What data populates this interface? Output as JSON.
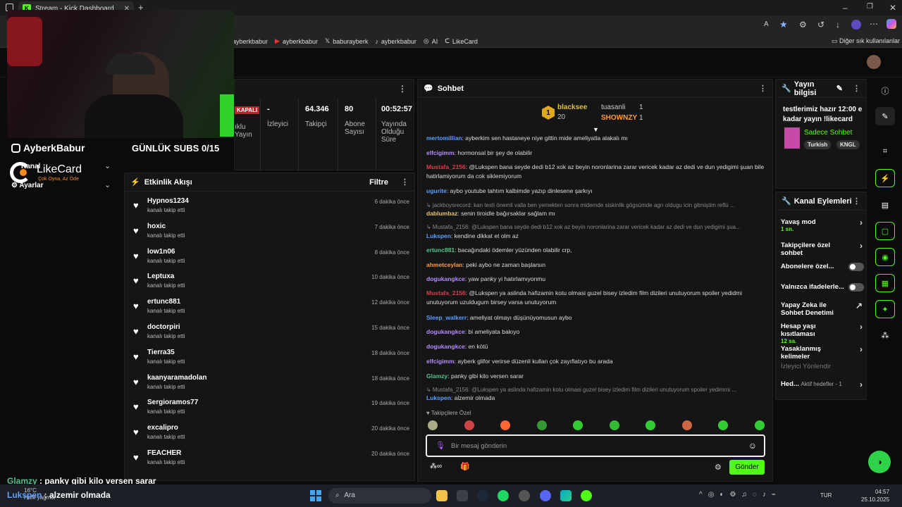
{
  "browser": {
    "tab_title": "Stream - Kick Dashboard",
    "bookmarks": [
      "ayberkbabur",
      "ayberkbabur",
      "baburayberk",
      "ayberkbabur",
      "AI",
      "LikeCard"
    ],
    "other_bookmarks": "Diğer sık kullanılanlar"
  },
  "overlay": {
    "instagram": "AyberkBabur",
    "daily_subs": "GÜNLÜK SUBS 0/15",
    "likecard": "LikeCard",
    "likecard_tag": "Çok Oyna, Az Öde",
    "menu_kanal": "Kanal",
    "menu_ayarlar": "Ayarlar"
  },
  "stream_stats": {
    "status": "KAPALI",
    "viewers_value": "-",
    "viewers_label": "İzleyici",
    "followers_value": "64.346",
    "followers_label": "Takipçi",
    "subs_value": "80",
    "subs_label": "Abone Sayısı",
    "uptime_value": "00:52:57",
    "uptime_label": "Yayında Olduğu Süre",
    "partial1": "Gelir",
    "partial2": "Yayın",
    "partial3": "ıklu"
  },
  "activity": {
    "title": "Etkinlik Akışı",
    "filter": "Filtre",
    "events": [
      {
        "name": "Hypnos1234",
        "sub": "kanalı takip etti",
        "time": "6 dakika önce"
      },
      {
        "name": "hoxic",
        "sub": "kanalı takip etti",
        "time": "7 dakika önce"
      },
      {
        "name": "low1n06",
        "sub": "kanalı takip etti",
        "time": "8 dakika önce"
      },
      {
        "name": "Leptuxa",
        "sub": "kanalı takip etti",
        "time": "10 dakika önce"
      },
      {
        "name": "ertunc881",
        "sub": "kanalı takip etti",
        "time": "12 dakika önce"
      },
      {
        "name": "doctorpiri",
        "sub": "kanalı takip etti",
        "time": "15 dakika önce"
      },
      {
        "name": "Tierra35",
        "sub": "kanalı takip etti",
        "time": "18 dakika önce"
      },
      {
        "name": "kaanyaramadolan",
        "sub": "kanalı takip etti",
        "time": "18 dakika önce"
      },
      {
        "name": "Sergioramos77",
        "sub": "kanalı takip etti",
        "time": "19 dakika önce"
      },
      {
        "name": "excalipro",
        "sub": "kanalı takip etti",
        "time": "20 dakika önce"
      },
      {
        "name": "FEACHER",
        "sub": "kanalı takip etti",
        "time": "20 dakika önce"
      }
    ]
  },
  "chat": {
    "title": "Sohbet",
    "leader_name": "blacksee",
    "leader_count": "20",
    "rank1_name": "tuasanli",
    "rank1_count": "1",
    "rank2_name": "SHOWNZY",
    "rank2_count": "1",
    "messages": [
      {
        "user": "mertomillian",
        "color": "#5aa0ff",
        "text": ": ayberkim sen hastaneye niye gittin mide ameliyatla alakalı mı"
      },
      {
        "user": "elfcigimm",
        "color": "#b68cff",
        "text": ": hormonsal bir şey de olabilir"
      },
      {
        "user": "Mustafa_2156",
        "color": "#e03a4a",
        "text": ": @Lukspen bana seyde dedi b12 xok az beyin noronlarina zarar vericek kadar az dedi ve dun yedigimi şuan bile hatirlamiyorum da cok siklemiyorum"
      },
      {
        "user": "ugurite",
        "color": "#5aa0ff",
        "text": ": aybo youtube tahtım kalbimde yazıp dinlesene şarkıyı"
      },
      {
        "reply": "↳ jackboysrecord: kan testi önemli valla ben yemekten sonra midemde siskinlik gögsümde agrı oldugu icin gitmiştim reflü ..."
      },
      {
        "user": "dablumbaz",
        "color": "#e7c66b",
        "text": ": senin tiroidle bağırsaklar sağlam mı"
      },
      {
        "reply": "↳ Mustafa_2156: @Lukspen bana seyde dedi b12 xok az beyin noronlarina zarar vericek kadar az dedi ve dun yedigimi şua..."
      },
      {
        "user": "Lukspen",
        "color": "#5aa0ff",
        "text": ": kendine dikkat et olm az"
      },
      {
        "user": "ertunc881",
        "color": "#53c28b",
        "text": ": bacağındaki ödemler yüzünden olabilir crp,"
      },
      {
        "user": "ahmetceylan",
        "color": "#ff9b3d",
        "text": ": peki aybo ne zaman başlarsın"
      },
      {
        "user": "dogukangkce",
        "color": "#b68cff",
        "text": ": yaw panky yi hatırlamıyonmu"
      },
      {
        "user": "Mustafa_2156",
        "color": "#e03a4a",
        "text": ": @Lukspen ya aslinda hafizamin kotu olmasi guzel bisey izledim film dizileri unutuyorum spoiler yedidmi unutuyorum uzuldugum birsey varsa unutuyorum"
      },
      {
        "user": "Sleep_walkerr",
        "color": "#5aa0ff",
        "text": ": ameliyat olmayı düşünüyomusun aybo"
      },
      {
        "user": "dogukangkce",
        "color": "#b68cff",
        "text": ": bi ameliyata bakıyo"
      },
      {
        "user": "dogukangkce",
        "color": "#b68cff",
        "text": ": en kötü"
      },
      {
        "user": "elfcigimm",
        "color": "#b68cff",
        "text": ": ayberk glifor verirse düzenli kullan çok zayıflatıyo bu arada"
      },
      {
        "user": "Glamzy",
        "color": "#53c28b",
        "text": ": panky gibi kilo versen sarar"
      },
      {
        "reply": "↳ Mustafa_2156: @Lukspen ya aslinda hafizamin kotu olmasi guzel bisey izledim film dizileri unutuyorum spoiler yedimmi ..."
      },
      {
        "user": "Lukspen",
        "color": "#5aa0ff",
        "text": ": alzemir olmada"
      }
    ],
    "followers_only": "Takipçilere Özel",
    "input_placeholder": "Bir mesaj gönderin",
    "send": "Gönder"
  },
  "stream_info": {
    "title": "Yayın bilgisi",
    "stream_title": "testlerimiz hazır 12:00 e kadar yayın !likecard",
    "category": "Sadece Sohbet",
    "tags": [
      "Turkish",
      "KNGL"
    ]
  },
  "channel_actions": {
    "title": "Kanal Eylemleri",
    "items": [
      {
        "label": "Yavaş mod",
        "sub": "1 sn."
      },
      {
        "label": "Takipçilere özel sohbet",
        "sub": ""
      },
      {
        "label": "Abonelere özel...",
        "sub": ""
      },
      {
        "label": "Yalnızca ifadelerle...",
        "sub": ""
      },
      {
        "label": "Yapay Zeka ile Sohbet Denetimi",
        "sub": ""
      },
      {
        "label": "Hesap yaşı kısıtlaması",
        "sub": "12 sa."
      },
      {
        "label": "Yasaklanmış kelimeler",
        "sub": ""
      },
      {
        "label": "İzleyici Yönlendir",
        "sub": ""
      },
      {
        "label": "Hed...",
        "sub": "Aktif hedefler - 1"
      }
    ]
  },
  "overlay_chat": {
    "line1_user": "Glamzy",
    "line1_text": " : panky gibi kilo versen sarar",
    "line2_user": "Lukspen",
    "line2_text": " : alzemir olmada"
  },
  "taskbar": {
    "weather_temp": "16°C",
    "weather_desc": "Hafif yağmur",
    "search": "Ara",
    "lang": "TUR",
    "time": "04:57",
    "date": "25.10.2025"
  }
}
